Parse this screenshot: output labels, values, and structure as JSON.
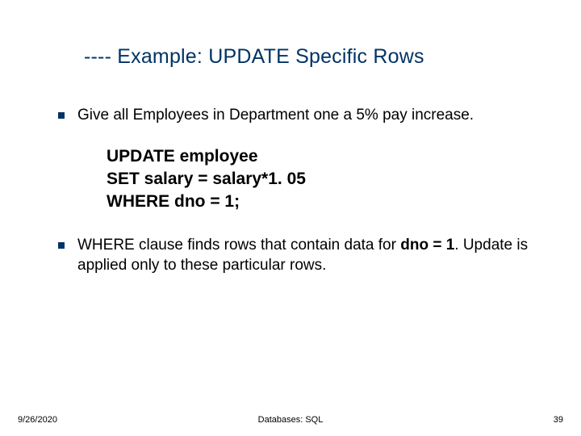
{
  "title": "---- Example: UPDATE Specific Rows",
  "bullets": [
    {
      "text": "Give all Employees in Department one a 5% pay increase."
    }
  ],
  "code": {
    "line1": "UPDATE employee",
    "line2": "SET salary = salary*1. 05",
    "line3": "WHERE dno = 1;"
  },
  "bullet2": {
    "prefix": "WHERE clause finds rows that contain data for ",
    "bold": "dno = 1",
    "suffix": ". Update is applied only to these particular rows."
  },
  "footer": {
    "date": "9/26/2020",
    "center": "Databases: SQL",
    "page": "39"
  }
}
